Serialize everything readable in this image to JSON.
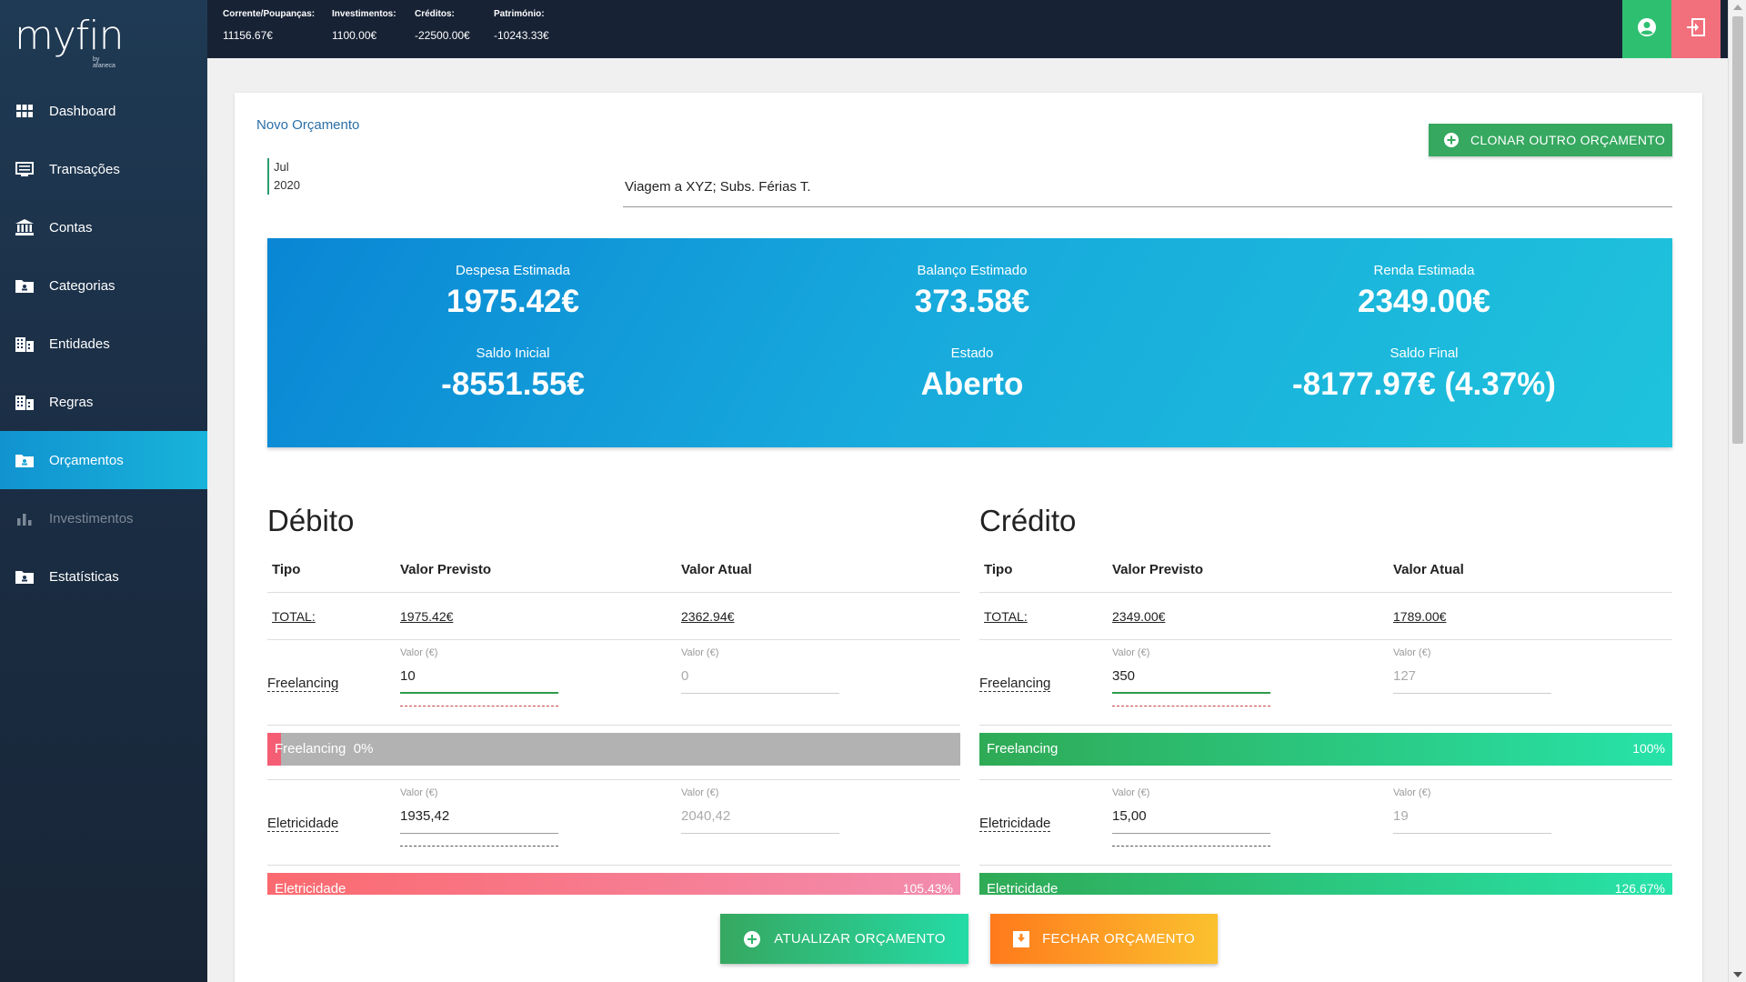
{
  "app": {
    "name": "myfin",
    "tagline": "by afaneca"
  },
  "topbar": {
    "stats": [
      {
        "label": "Corrente/Poupanças:",
        "value": "11156.67€"
      },
      {
        "label": "Investimentos:",
        "value": "1100.00€"
      },
      {
        "label": "Créditos:",
        "value": "-22500.00€"
      },
      {
        "label": "Património:",
        "value": "-10243.33€"
      }
    ],
    "user_icon": "user-circle-icon",
    "logout_icon": "logout-icon",
    "colors": {
      "user": "#2fbf71",
      "logout": "#f2707c"
    }
  },
  "sidebar": {
    "items": [
      {
        "label": "Dashboard",
        "icon": "grid-icon"
      },
      {
        "label": "Transações",
        "icon": "list-icon"
      },
      {
        "label": "Contas",
        "icon": "bank-icon"
      },
      {
        "label": "Categorias",
        "icon": "folder-icon"
      },
      {
        "label": "Entidades",
        "icon": "building-icon"
      },
      {
        "label": "Regras",
        "icon": "building-icon"
      },
      {
        "label": "Orçamentos",
        "icon": "folder-icon",
        "active": true
      },
      {
        "label": "Investimentos",
        "icon": "bar-chart-icon",
        "disabled": true
      },
      {
        "label": "Estatísticas",
        "icon": "folder-icon"
      }
    ]
  },
  "budget": {
    "title": "Novo Orçamento",
    "clone_label": "CLONAR OUTRO ORÇAMENTO",
    "month": "Jul",
    "year": "2020",
    "description": "Viagem a XYZ; Subs. Férias T."
  },
  "summary": {
    "despesa_label": "Despesa Estimada",
    "despesa_value": "1975.42€",
    "balanco_label": "Balanço Estimado",
    "balanco_value": "373.58€",
    "renda_label": "Renda Estimada",
    "renda_value": "2349.00€",
    "saldo_inicial_label": "Saldo Inicial",
    "saldo_inicial_value": "-8551.55€",
    "estado_label": "Estado",
    "estado_value": "Aberto",
    "saldo_final_label": "Saldo Final",
    "saldo_final_value": "-8177.97€ (4.37%)"
  },
  "debit": {
    "title": "Débito",
    "headers": {
      "tipo": "Tipo",
      "previsto": "Valor Previsto",
      "atual": "Valor Atual"
    },
    "total_label": "TOTAL:",
    "total_previsto": "1975.42€",
    "total_atual": "2362.94€",
    "field_caption": "Valor (€)",
    "entries": [
      {
        "name": "Freelancing",
        "previsto": "10",
        "atual": "0",
        "bar_label": "Freelancing",
        "bar_pct": "0%",
        "progress": 0.02
      },
      {
        "name": "Eletricidade",
        "previsto": "1935,42",
        "atual": "2040,42",
        "bar_label": "Eletricidade",
        "bar_pct": "105.43%",
        "progress": 1.0
      }
    ]
  },
  "credit": {
    "title": "Crédito",
    "headers": {
      "tipo": "Tipo",
      "previsto": "Valor Previsto",
      "atual": "Valor Atual"
    },
    "total_label": "TOTAL:",
    "total_previsto": "2349.00€",
    "total_atual": "1789.00€",
    "field_caption": "Valor (€)",
    "entries": [
      {
        "name": "Freelancing",
        "previsto": "350",
        "atual": "127",
        "bar_label": "Freelancing",
        "bar_pct": "100%",
        "progress": 1.0
      },
      {
        "name": "Eletricidade",
        "previsto": "15,00",
        "atual": "19",
        "bar_label": "Eletricidade",
        "bar_pct": "126.67%",
        "progress": 1.0
      }
    ]
  },
  "actions": {
    "update_label": "ATUALIZAR ORÇAMENTO",
    "close_label": "FECHAR ORÇAMENTO"
  }
}
